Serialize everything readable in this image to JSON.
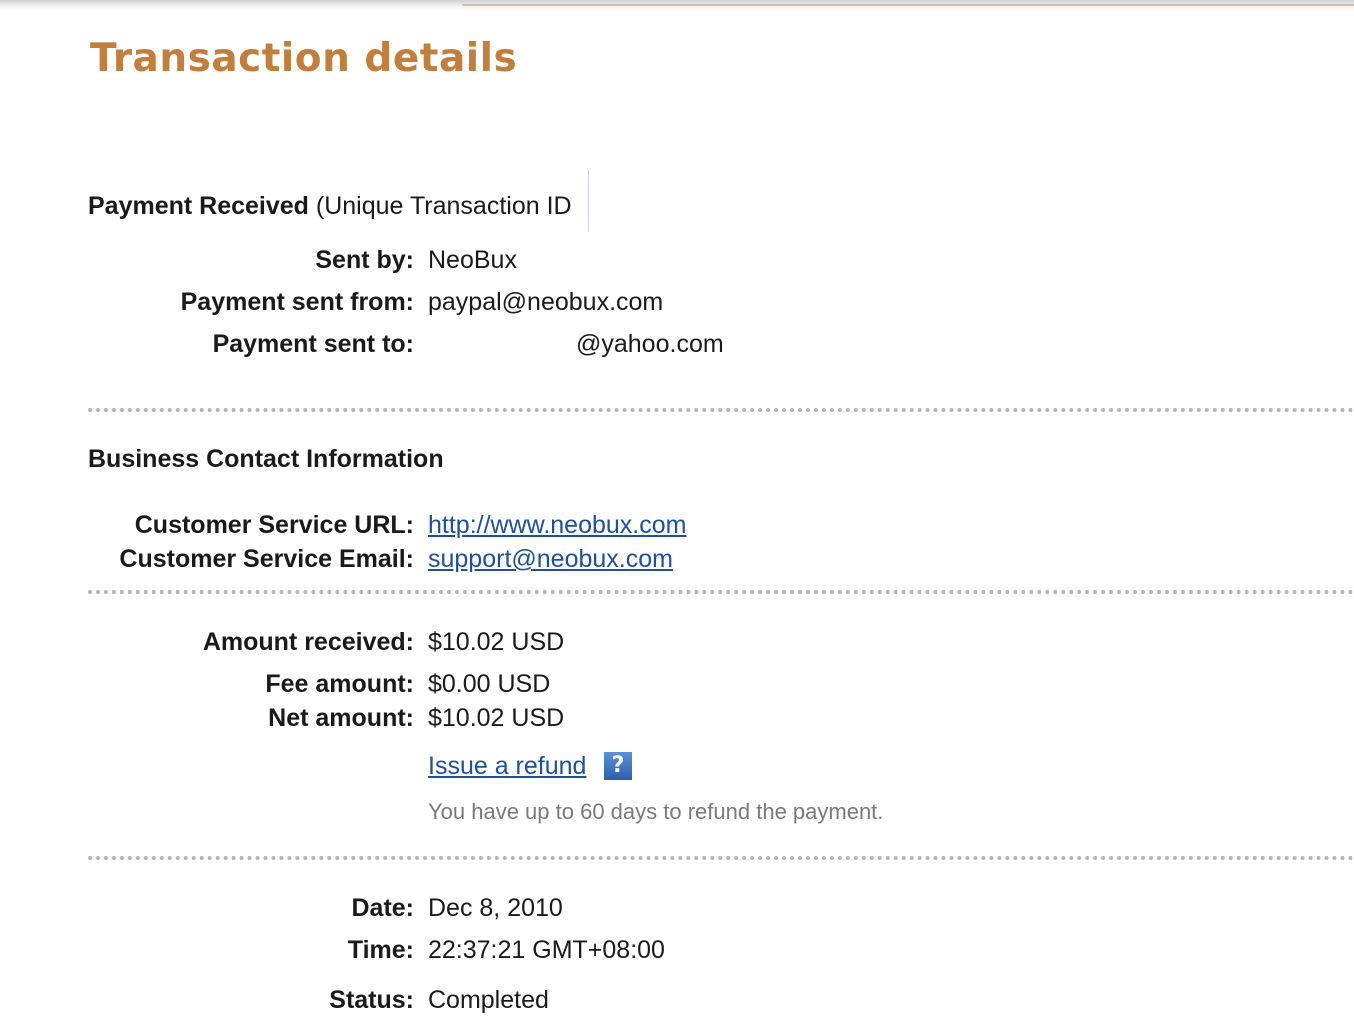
{
  "page": {
    "title": "Transaction details"
  },
  "payment": {
    "heading_strong": "Payment Received",
    "heading_rest": " (Unique Transaction ID",
    "sent_by_label": "Sent by:",
    "sent_by_value": "NeoBux",
    "sent_from_label": "Payment sent from:",
    "sent_from_value": "paypal@neobux.com",
    "sent_to_label": "Payment sent to:",
    "sent_to_value": "@yahoo.com"
  },
  "business": {
    "heading": "Business Contact Information",
    "url_label": "Customer Service URL:",
    "url_value": "http://www.neobux.com",
    "email_label": "Customer Service Email:",
    "email_value": "support@neobux.com"
  },
  "amounts": {
    "received_label": "Amount received:",
    "received_value": "$10.02 USD",
    "fee_label": "Fee amount:",
    "fee_value": "$0.00 USD",
    "net_label": "Net amount:",
    "net_value": "$10.02 USD",
    "refund_link": "Issue a refund",
    "help_glyph": "?",
    "help_icon": "question-mark-icon",
    "refund_note": "You have up to 60 days to refund the payment."
  },
  "details": {
    "date_label": "Date:",
    "date_value": "Dec 8, 2010",
    "time_label": "Time:",
    "time_value": "22:37:21 GMT+08:00",
    "status_label": "Status:",
    "status_value": "Completed"
  },
  "colors": {
    "title": "#c27e3c",
    "link": "#1f4f9a",
    "note": "#7a7a7a",
    "help_icon": "#3a6bbf"
  }
}
